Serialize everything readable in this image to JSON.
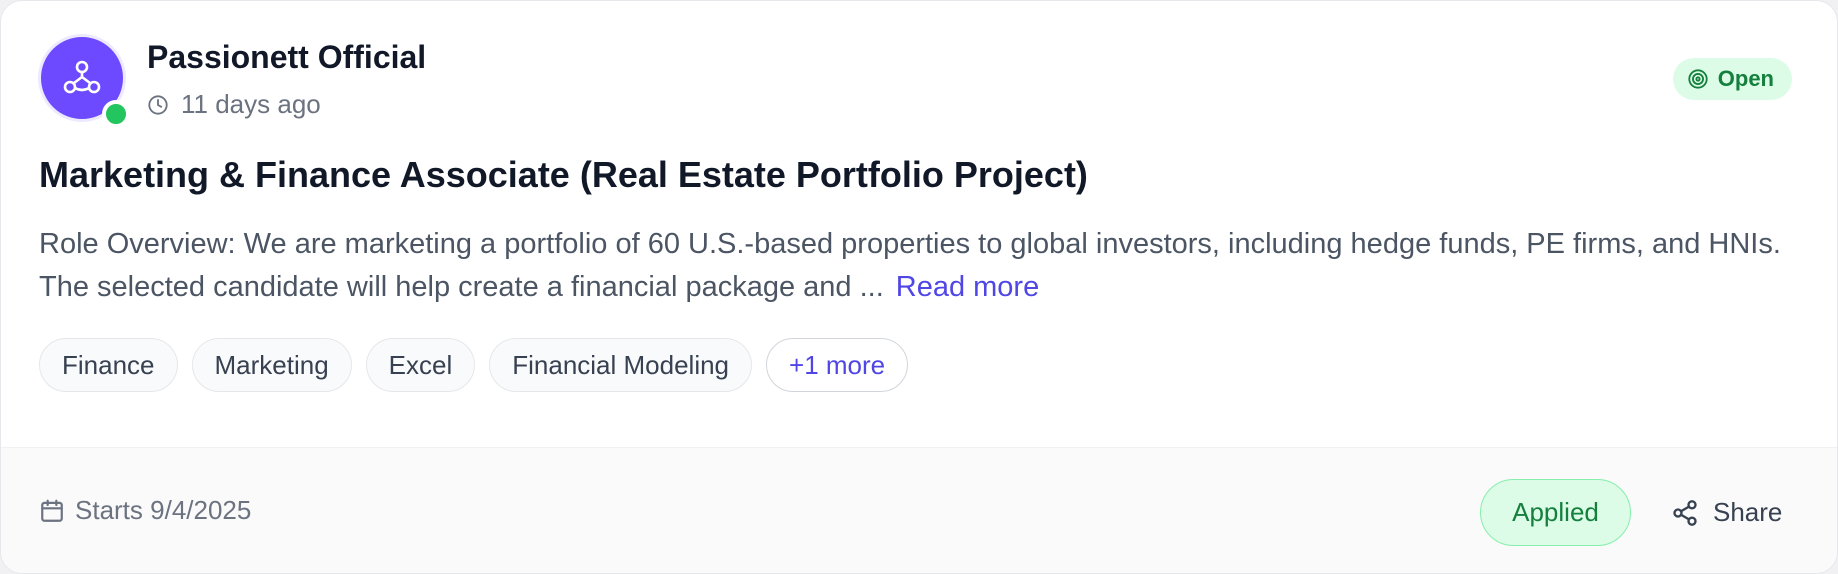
{
  "organization": {
    "name": "Passionett Official",
    "posted_ago": "11 days ago",
    "avatar_icon": "people-network-icon",
    "online_color": "#22c55e"
  },
  "status": {
    "label": "Open",
    "icon": "target-icon",
    "color": "#15803d"
  },
  "job": {
    "title": "Marketing & Finance Associate (Real Estate Portfolio Project)",
    "description": "Role Overview: We are marketing a portfolio of 60 U.S.-based properties to global investors, including hedge funds, PE firms, and HNIs. The selected candidate will help create a financial package and ...",
    "read_more": "Read more"
  },
  "tags": {
    "items": [
      "Finance",
      "Marketing",
      "Excel",
      "Financial Modeling"
    ],
    "more": "+1 more"
  },
  "footer": {
    "start_date": "Starts 9/4/2025",
    "applied_label": "Applied",
    "share_label": "Share"
  },
  "colors": {
    "accent": "#4f46e5",
    "avatar_bg": "#6d4aff",
    "success_bg": "#dcfce7"
  }
}
